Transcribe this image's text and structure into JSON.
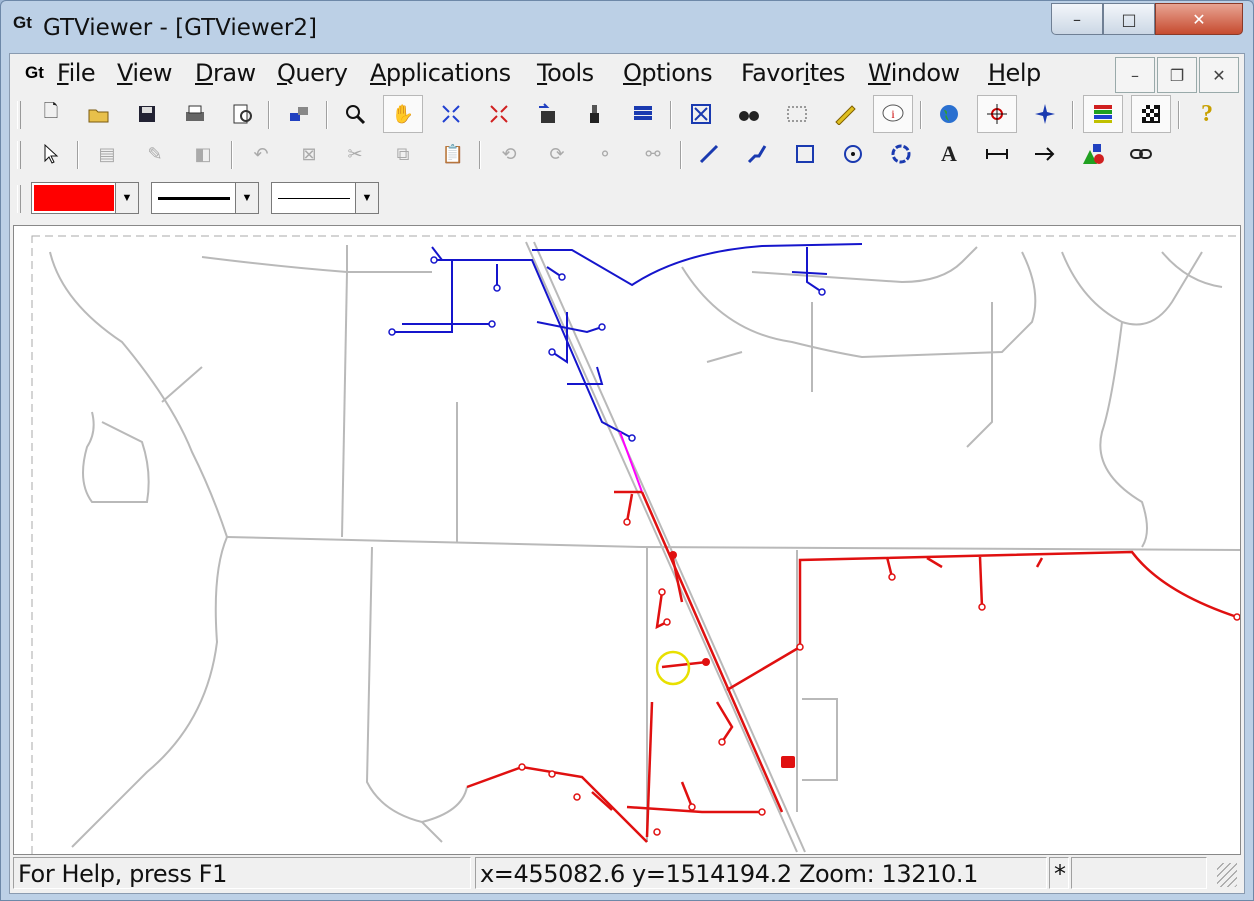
{
  "window": {
    "title": "GTViewer - [GTViewer2]",
    "icon_text": "Gt",
    "min_symbol": "–",
    "max_symbol": "□",
    "close_symbol": "✕"
  },
  "menubar": {
    "logo": "Gt",
    "items": [
      {
        "label": "File",
        "accel": "F",
        "rest": "ile"
      },
      {
        "label": "View",
        "accel": "V",
        "rest": "iew"
      },
      {
        "label": "Draw",
        "accel": "D",
        "rest": "raw"
      },
      {
        "label": "Query",
        "accel": "Q",
        "rest": "uery"
      },
      {
        "label": "Applications",
        "accel": "A",
        "rest": "pplications"
      },
      {
        "label": "Tools",
        "accel": "T",
        "rest": "ools"
      },
      {
        "label": "Options",
        "accel": "O",
        "rest": "ptions"
      },
      {
        "label": "Favorites",
        "pre": "Favor",
        "accel": "i",
        "rest": "tes"
      },
      {
        "label": "Window",
        "accel": "W",
        "rest": "indow"
      },
      {
        "label": "Help",
        "accel": "H",
        "rest": "elp"
      }
    ],
    "mdi_min": "–",
    "mdi_restore": "❐",
    "mdi_close": "✕"
  },
  "toolbar1": {
    "icons": [
      "new-file-icon",
      "open-folder-icon",
      "save-icon",
      "print-icon",
      "print-preview-icon",
      "layers-icon",
      "zoom-icon",
      "pan-hand-icon",
      "fit-extent-icon",
      "zoom-fit-red-icon",
      "export-icon",
      "paint-bucket-icon",
      "stack-layers-icon",
      "zoom-extents-icon",
      "binoculars-icon",
      "select-rect-icon",
      "measure-ruler-icon",
      "info-balloon-icon",
      "globe-icon",
      "snap-target-icon",
      "star-point-icon",
      "color-bars-icon",
      "checker-icon",
      "help-icon"
    ]
  },
  "toolbar2": {
    "icons": [
      "select-arrow-icon",
      "properties-icon",
      "edit-icon",
      "toggle-icon",
      "undo-icon",
      "delete-icon",
      "cut-icon",
      "copy-icon",
      "paste-icon",
      "rotate-left-icon",
      "rotate-right-icon",
      "link-node-icon",
      "unlink-node-icon",
      "draw-line-icon",
      "draw-polyline-icon",
      "draw-rectangle-icon",
      "draw-circle-icon",
      "draw-polygon-icon",
      "text-icon",
      "dimension-icon",
      "arrow-icon",
      "symbols-icon",
      "chain-link-icon"
    ],
    "text_icon_glyph": "A"
  },
  "toolbar3": {
    "color_value": "#ff0000",
    "line_style": "solid-thick",
    "line_weight": "solid-thin"
  },
  "map": {
    "colors": {
      "road": "#b9b9b9",
      "blue_network": "#1515cc",
      "red_network": "#e01010",
      "highlight": "#ff00ff",
      "cursor": "#e8e000"
    }
  },
  "statusbar": {
    "help": "For Help, press F1",
    "coords": "x=455082.6 y=1514194.2  Zoom: 13210.1",
    "flag": "*",
    "extra": ""
  }
}
